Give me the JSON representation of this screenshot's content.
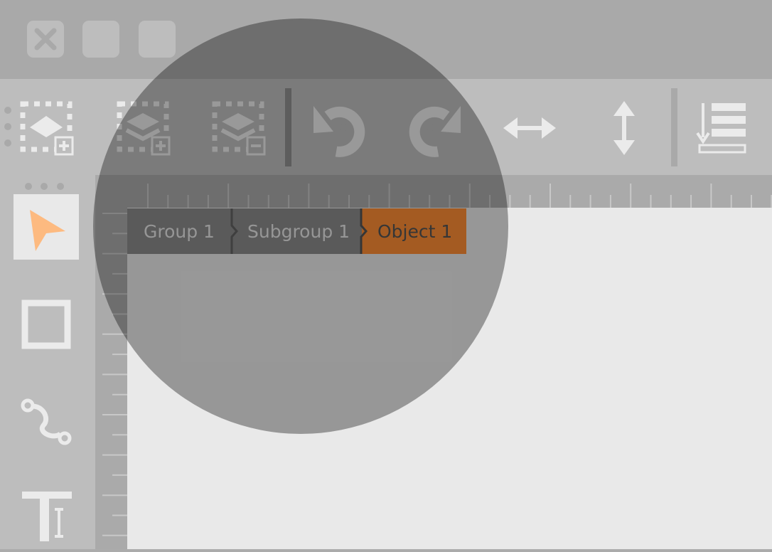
{
  "window": {
    "buttons": [
      {
        "name": "close",
        "icon": "close-icon"
      },
      {
        "name": "minimize",
        "icon": "blank-square"
      },
      {
        "name": "maximize",
        "icon": "blank-square"
      }
    ]
  },
  "toolbar": {
    "items": [
      {
        "name": "add-group",
        "icon": "add-group-icon"
      },
      {
        "name": "add-layer",
        "icon": "add-layer-icon"
      },
      {
        "name": "remove-layer",
        "icon": "remove-layer-icon"
      },
      {
        "name": "undo",
        "icon": "undo-icon"
      },
      {
        "name": "redo",
        "icon": "redo-icon"
      },
      {
        "name": "flip-horizontal",
        "icon": "horizontal-arrows-icon"
      },
      {
        "name": "flip-vertical",
        "icon": "vertical-arrows-icon"
      },
      {
        "name": "align-bottom",
        "icon": "align-bottom-icon"
      }
    ]
  },
  "tools": [
    {
      "name": "select",
      "icon": "pointer-arrow-icon",
      "active": true
    },
    {
      "name": "rectangle",
      "icon": "square-outline-icon"
    },
    {
      "name": "path",
      "icon": "bezier-curve-icon"
    },
    {
      "name": "text",
      "icon": "text-tool-icon"
    }
  ],
  "breadcrumb": {
    "items": [
      "Group 1",
      "Subgroup 1",
      "Object 1"
    ],
    "active_index": 2
  },
  "colors": {
    "accent": "#fc8d35",
    "canvas": "#e9e9e9",
    "toolbar": "#bdbdbd",
    "titlebar": "#a9a9a9",
    "icon": "#ebebeb"
  }
}
